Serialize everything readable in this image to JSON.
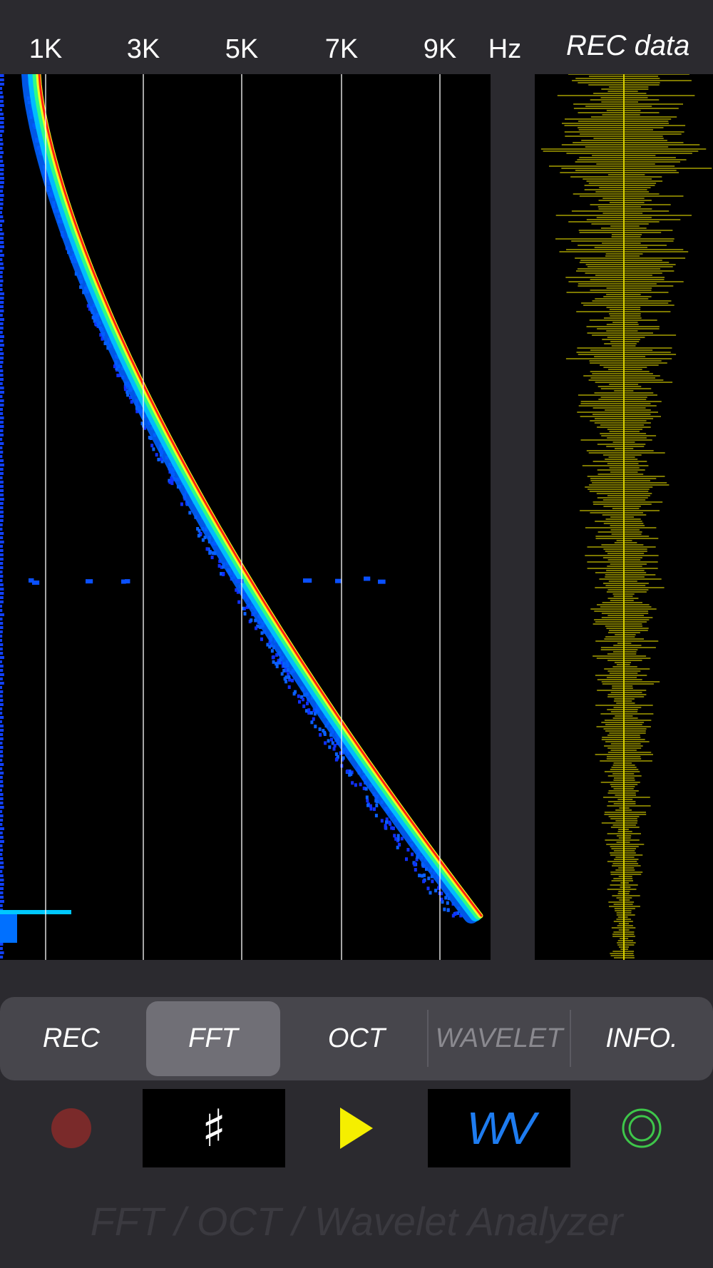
{
  "header": {
    "freq_labels": [
      "1K",
      "3K",
      "5K",
      "7K",
      "9K",
      "Hz"
    ],
    "rec_title": "REC data"
  },
  "tabs": [
    {
      "label": "REC",
      "state": "normal"
    },
    {
      "label": "FFT",
      "state": "selected"
    },
    {
      "label": "OCT",
      "state": "normal"
    },
    {
      "label": "WAVELET",
      "state": "disabled"
    },
    {
      "label": "INFO.",
      "state": "normal"
    }
  ],
  "controls": {
    "record_icon": "record-dot-icon",
    "grid_icon": "hash-icon",
    "grid_symbol": "♯",
    "play_icon": "play-icon",
    "wavelet_icon": "wv-icon",
    "wavelet_text": "WV",
    "target_icon": "concentric-circle-icon"
  },
  "colors": {
    "background": "#2b2a2f",
    "play": "#f5ef00",
    "record": "#7a2a2a",
    "wavelet_text": "#1e7cf0",
    "target": "#3ec64a",
    "waveform": "#c8c000"
  },
  "footer": {
    "title": "FFT / OCT / Wavelet Analyzer"
  }
}
